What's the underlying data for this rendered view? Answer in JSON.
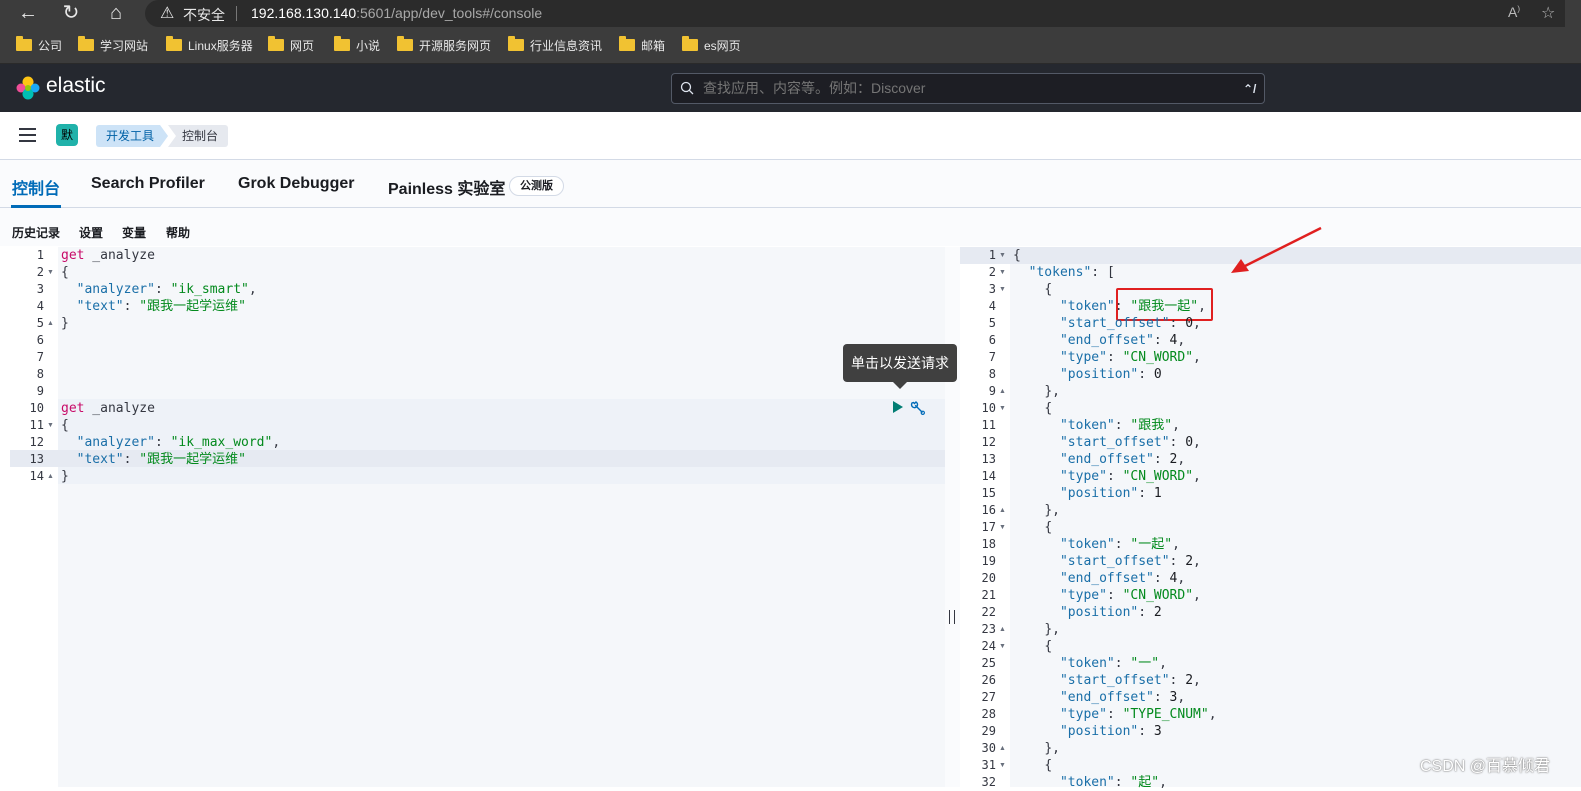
{
  "browser": {
    "security_label": "不安全",
    "url_host": "192.168.130.140",
    "url_rest": ":5601/app/dev_tools#/console",
    "bookmarks": [
      "公司",
      "学习网站",
      "Linux服务器",
      "网页",
      "小说",
      "开源服务网页",
      "行业信息资讯",
      "邮箱",
      "es网页"
    ]
  },
  "header": {
    "logo_text": "elastic",
    "search_placeholder": "查找应用、内容等。例如：Discover",
    "search_shortcut": "⌃/"
  },
  "breadcrumbs": {
    "space_initial": "默",
    "items": [
      "开发工具",
      "控制台"
    ]
  },
  "tabs": [
    {
      "label": "控制台",
      "active": true
    },
    {
      "label": "Search Profiler"
    },
    {
      "label": "Grok Debugger"
    },
    {
      "label": "Painless 实验室",
      "badge": "公测版"
    }
  ],
  "toolbar": [
    "历史记录",
    "设置",
    "变量",
    "帮助"
  ],
  "tooltip": "单击以发送请求",
  "request_lines": [
    "get _analyze",
    "{",
    "  \"analyzer\": \"ik_smart\",",
    "  \"text\": \"跟我一起学运维\"",
    "}",
    "",
    "",
    "",
    "",
    "get _analyze",
    "{",
    "  \"analyzer\": \"ik_max_word\",",
    "  \"text\": \"跟我一起学运维\"",
    "}"
  ],
  "response_lines": [
    "{",
    "  \"tokens\": [",
    "    {",
    "      \"token\": \"跟我一起\",",
    "      \"start_offset\": 0,",
    "      \"end_offset\": 4,",
    "      \"type\": \"CN_WORD\",",
    "      \"position\": 0",
    "    },",
    "    {",
    "      \"token\": \"跟我\",",
    "      \"start_offset\": 0,",
    "      \"end_offset\": 2,",
    "      \"type\": \"CN_WORD\",",
    "      \"position\": 1",
    "    },",
    "    {",
    "      \"token\": \"一起\",",
    "      \"start_offset\": 2,",
    "      \"end_offset\": 4,",
    "      \"type\": \"CN_WORD\",",
    "      \"position\": 2",
    "    },",
    "    {",
    "      \"token\": \"一\",",
    "      \"start_offset\": 2,",
    "      \"end_offset\": 3,",
    "      \"type\": \"TYPE_CNUM\",",
    "      \"position\": 3",
    "    },",
    "    {",
    "      \"token\": \"起\","
  ],
  "watermark": "CSDN @百慕倾君",
  "colors": {
    "header_bg": "#25282f",
    "accent": "#006bb8",
    "string": "#038a1d",
    "keyword": "#c80a68",
    "annotation_red": "#e02020"
  }
}
